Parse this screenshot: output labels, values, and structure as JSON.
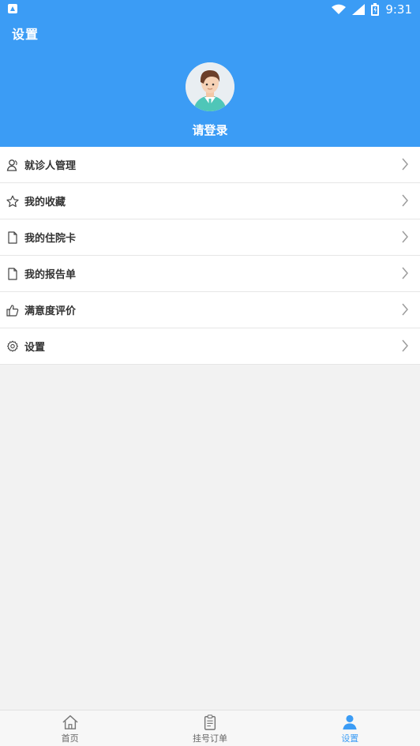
{
  "statusBar": {
    "time": "9:31"
  },
  "header": {
    "title": "设置",
    "loginText": "请登录"
  },
  "menu": {
    "items": [
      {
        "label": "就诊人管理",
        "icon": "patient-icon"
      },
      {
        "label": "我的收藏",
        "icon": "star-icon"
      },
      {
        "label": "我的住院卡",
        "icon": "document-icon"
      },
      {
        "label": "我的报告单",
        "icon": "document-icon"
      },
      {
        "label": "满意度评价",
        "icon": "thumbs-up-icon"
      },
      {
        "label": "设置",
        "icon": "gear-icon"
      }
    ]
  },
  "bottomNav": {
    "items": [
      {
        "label": "首页",
        "icon": "home-icon"
      },
      {
        "label": "挂号订单",
        "icon": "clipboard-icon"
      },
      {
        "label": "设置",
        "icon": "user-icon",
        "active": true
      }
    ]
  },
  "colors": {
    "primary": "#3b9cf5",
    "background": "#f2f2f2"
  }
}
